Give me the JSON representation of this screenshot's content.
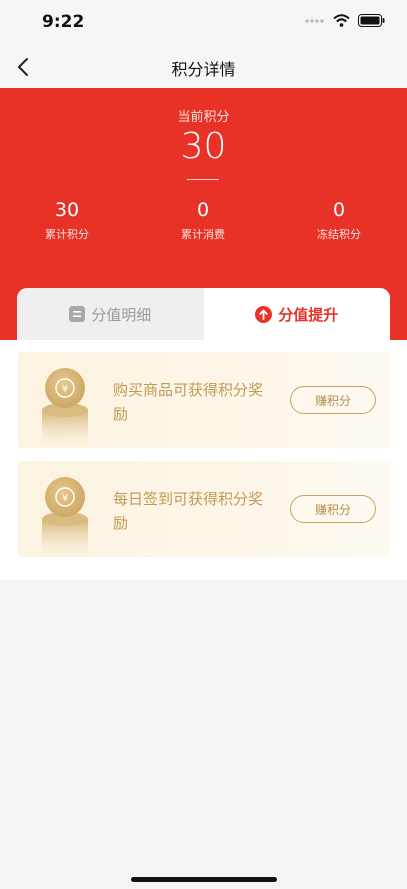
{
  "status_bar": {
    "time": "9:22"
  },
  "nav": {
    "title": "积分详情"
  },
  "hero": {
    "label": "当前积分",
    "value": "30",
    "stats": [
      {
        "value": "30",
        "label": "累计积分"
      },
      {
        "value": "0",
        "label": "累计消费"
      },
      {
        "value": "0",
        "label": "冻结积分"
      }
    ]
  },
  "tabs": [
    {
      "label": "分值明细",
      "icon": "list-icon",
      "active": false
    },
    {
      "label": "分值提升",
      "icon": "arrow-up-circle-icon",
      "active": true
    }
  ],
  "cards": [
    {
      "text": "购买商品可获得积分奖励",
      "button": "赚积分"
    },
    {
      "text": "每日签到可获得积分奖励",
      "button": "赚积分"
    }
  ],
  "colors": {
    "brand_red": "#e83228",
    "gold_text": "#c19a55",
    "card_bg": "#fcf3e0"
  }
}
